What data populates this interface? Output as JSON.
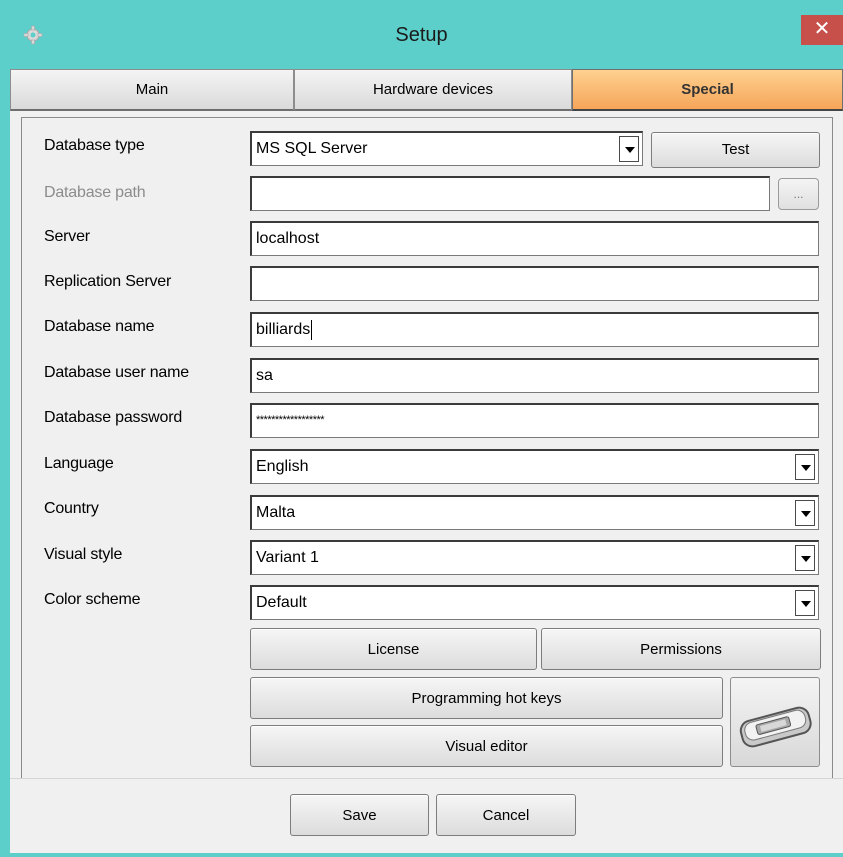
{
  "window": {
    "title": "Setup"
  },
  "tabs": [
    {
      "label": "Main"
    },
    {
      "label": "Hardware devices"
    },
    {
      "label": "Special"
    }
  ],
  "form": {
    "database_type": {
      "label": "Database type",
      "value": "MS SQL Server"
    },
    "test_button": "Test",
    "database_path": {
      "label": "Database path",
      "value": ""
    },
    "browse_button": "...",
    "server": {
      "label": "Server",
      "value": "localhost"
    },
    "replication_server": {
      "label": "Replication Server",
      "value": ""
    },
    "database_name": {
      "label": "Database name",
      "value": "billiards"
    },
    "database_user_name": {
      "label": "Database user name",
      "value": "sa"
    },
    "database_password": {
      "label": "Database password",
      "value": "******************"
    },
    "language": {
      "label": "Language",
      "value": "English"
    },
    "country": {
      "label": "Country",
      "value": "Malta"
    },
    "visual_style": {
      "label": "Visual style",
      "value": "Variant 1"
    },
    "color_scheme": {
      "label": "Color scheme",
      "value": "Default"
    }
  },
  "buttons": {
    "license": "License",
    "permissions": "Permissions",
    "programming_hot_keys": "Programming hot keys",
    "visual_editor": "Visual editor",
    "save": "Save",
    "cancel": "Cancel"
  },
  "colors": {
    "title_bar": "#5ccfcb",
    "active_tab": "#f6a55a",
    "close_button": "#c7504a"
  }
}
